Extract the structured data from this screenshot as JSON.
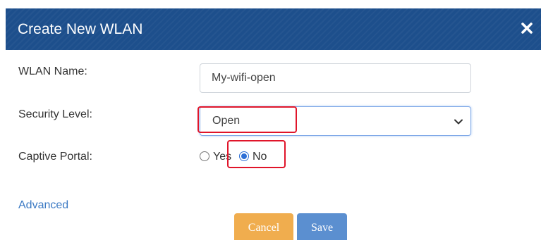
{
  "dialog": {
    "title": "Create New WLAN",
    "close_icon": "close-x-icon"
  },
  "form": {
    "wlan_name": {
      "label": "WLAN Name:",
      "value": "My-wifi-open"
    },
    "security_level": {
      "label": "Security Level:",
      "selected": "Open",
      "icon": "chevron-down-icon"
    },
    "captive_portal": {
      "label": "Captive Portal:",
      "options": [
        {
          "label": "Yes",
          "checked": false
        },
        {
          "label": "No",
          "checked": true
        }
      ]
    },
    "advanced_link": "Advanced"
  },
  "buttons": {
    "cancel": "Cancel",
    "save": "Save"
  },
  "colors": {
    "header": "#1d4f8c",
    "annotation": "#e0152a",
    "cancel": "#f0ad4e",
    "save": "#5b8fd0",
    "link": "#3c7ac4"
  }
}
